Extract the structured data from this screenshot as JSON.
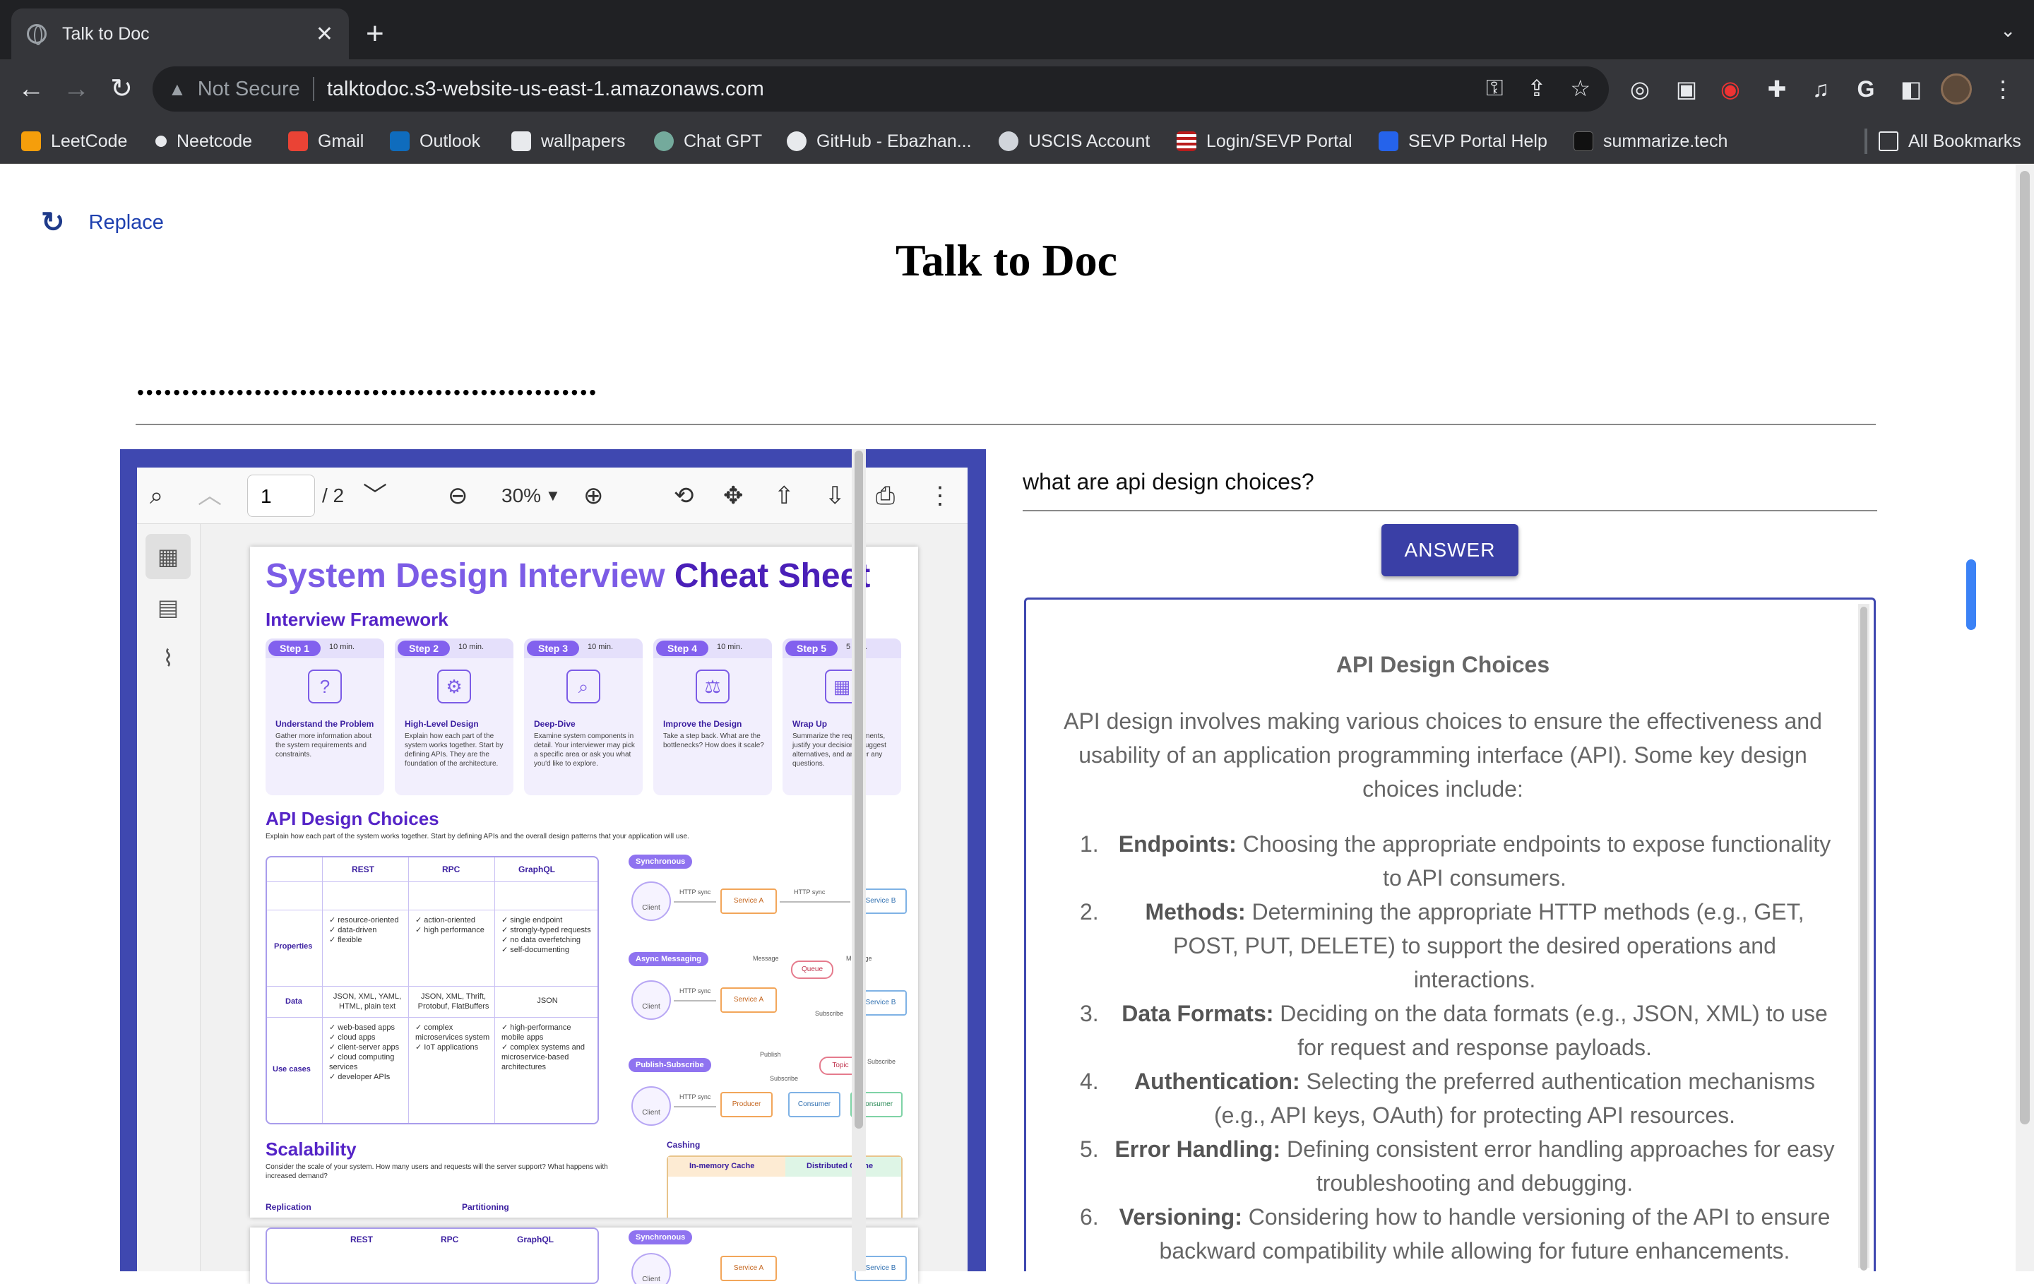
{
  "browser": {
    "tab_title": "Talk to Doc",
    "new_tab": "+",
    "security_label": "Not Secure",
    "url": "talktodoc.s3-website-us-east-1.amazonaws.com",
    "bookmarks": [
      {
        "label": "LeetCode",
        "color": "#f59e0b"
      },
      {
        "label": "Neetcode",
        "color": "#e8eaed"
      },
      {
        "label": "Gmail",
        "color": "#ea4335"
      },
      {
        "label": "Outlook",
        "color": "#0f6cbd"
      },
      {
        "label": "wallpapers",
        "color": "#e8eaed"
      },
      {
        "label": "Chat GPT",
        "color": "#74aa9c"
      },
      {
        "label": "GitHub - Ebazhan...",
        "color": "#e8eaed"
      },
      {
        "label": "USCIS Account",
        "color": "#d1d5db"
      },
      {
        "label": "Login/SEVP Portal",
        "color": "#b91c1c"
      },
      {
        "label": "SEVP Portal Help",
        "color": "#2563eb"
      },
      {
        "label": "summarize.tech",
        "color": "#111111"
      }
    ],
    "all_bookmarks": "All Bookmarks"
  },
  "page": {
    "replace_label": "Replace",
    "title": "Talk to Doc",
    "api_key_value": "•••••••••••••••••••••••••••••••••••••••••••••••••••"
  },
  "viewer": {
    "page_current": "1",
    "page_total": "/ 2",
    "zoom": "30%",
    "pdf": {
      "title_light": "System Design Interview",
      "title_dark": "Cheat Sheet",
      "framework_heading": "Interview Framework",
      "steps": [
        {
          "label": "Step 1",
          "time": "10 min.",
          "title": "Understand the Problem",
          "desc": "Gather more information about the system requirements and constraints.",
          "icon": "?"
        },
        {
          "label": "Step 2",
          "time": "10 min.",
          "title": "High-Level Design",
          "desc": "Explain how each part of the system works together. Start by defining APIs. They are the foundation of the architecture.",
          "icon": "⚙"
        },
        {
          "label": "Step 3",
          "time": "10 min.",
          "title": "Deep-Dive",
          "desc": "Examine system components in detail. Your interviewer may pick a specific area or ask you what you'd like to explore.",
          "icon": "⌕"
        },
        {
          "label": "Step 4",
          "time": "10 min.",
          "title": "Improve the Design",
          "desc": "Take a step back. What are the bottlenecks? How does it scale?",
          "icon": "⚖"
        },
        {
          "label": "Step 5",
          "time": "5 min.",
          "title": "Wrap Up",
          "desc": "Summarize the requirements, justify your decisions, suggest alternatives, and answer any questions.",
          "icon": "▦"
        }
      ],
      "api_heading": "API Design Choices",
      "api_sub": "Explain how each part of the system works together. Start by defining APIs and the overall design patterns that your application will use.",
      "table_headers": [
        "REST",
        "RPC",
        "GraphQL"
      ],
      "row_labels": [
        "Properties",
        "Data",
        "Use cases"
      ],
      "properties": [
        "✓ resource-oriented\n✓ data-driven\n✓ flexible",
        "✓ action-oriented\n✓ high performance",
        "✓ single endpoint\n✓ strongly-typed requests\n✓ no data overfetching\n✓ self-documenting"
      ],
      "data_cells": [
        "JSON, XML, YAML, HTML, plain text",
        "JSON, XML, Thrift, Protobuf, FlatBuffers",
        "JSON"
      ],
      "use_cases": [
        "✓ web-based apps\n✓ cloud apps\n✓ client-server apps\n✓ cloud computing services\n✓ developer APIs",
        "✓ complex microservices system\n✓ IoT applications",
        "✓ high-performance mobile apps\n✓ complex systems and microservice-based architectures"
      ],
      "patterns": {
        "sync": "Synchronous",
        "async": "Async Messaging",
        "pubsub": "Publish-Subscribe",
        "client": "Client",
        "http_sync": "HTTP sync",
        "service_a": "Service A",
        "service_b": "Service B",
        "queue": "Queue",
        "message": "Message",
        "subscribe": "Subscribe",
        "publish": "Publish",
        "topic": "Topic",
        "producer": "Producer",
        "consumer": "Consumer"
      },
      "scalability_heading": "Scalability",
      "scalability_sub": "Consider the scale of your system. How many users and requests will the server support? What happens with increased demand?",
      "caching": "Cashing",
      "inmem": "In-memory Cache",
      "distributed": "Distributed Cache",
      "replication": "Replication",
      "partitioning": "Partitioning"
    }
  },
  "qa": {
    "question": "what are api design choices?",
    "button": "ANSWER",
    "answer_title": "API Design Choices",
    "answer_intro": "API design involves making various choices to ensure the effectiveness and usability of an application programming interface (API). Some key design choices include:",
    "items": [
      {
        "num": "1.",
        "term": "Endpoints:",
        "text": " Choosing the appropriate endpoints to expose functionality to API consumers."
      },
      {
        "num": "2.",
        "term": "Methods:",
        "text": " Determining the appropriate HTTP methods (e.g., GET, POST, PUT, DELETE) to support the desired operations and interactions."
      },
      {
        "num": "3.",
        "term": "Data Formats:",
        "text": " Deciding on the data formats (e.g., JSON, XML) to use for request and response payloads."
      },
      {
        "num": "4.",
        "term": "Authentication:",
        "text": " Selecting the preferred authentication mechanisms (e.g., API keys, OAuth) for protecting API resources."
      },
      {
        "num": "5.",
        "term": "Error Handling:",
        "text": " Defining consistent error handling approaches for easy troubleshooting and debugging."
      },
      {
        "num": "6.",
        "term": "Versioning:",
        "text": " Considering how to handle versioning of the API to ensure backward compatibility while allowing for future enhancements."
      }
    ]
  }
}
